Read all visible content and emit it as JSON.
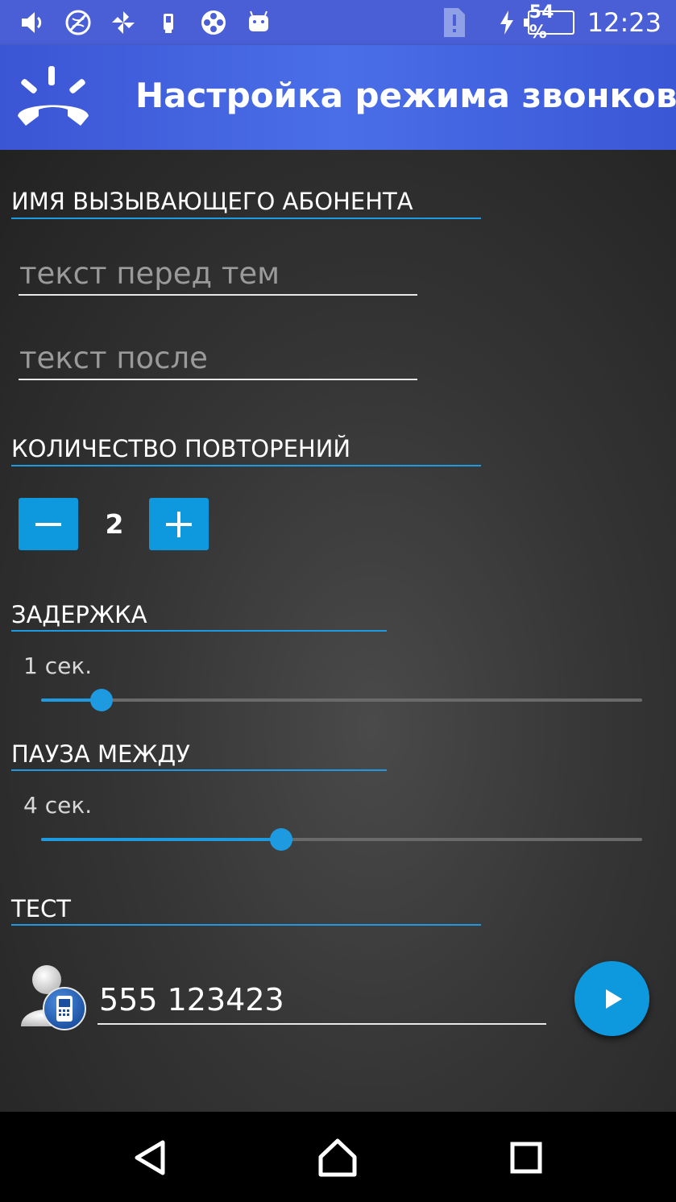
{
  "status_bar": {
    "icons": [
      "volume-icon",
      "no-network-icon",
      "pinwheel-icon",
      "device-icon",
      "film-reel-icon",
      "android-icon",
      "alert-sim-icon",
      "charging-icon"
    ],
    "battery": "54 %",
    "time": "12:23"
  },
  "app_bar": {
    "icon": "phone-ringing-icon",
    "title": "Настройка режима звонков"
  },
  "caller_name": {
    "title": "ИМЯ ВЫЗЫВАЮЩЕГО АБОНЕНТА",
    "before_placeholder": "текст перед тем",
    "after_placeholder": "текст после"
  },
  "repeat_count": {
    "title": "КОЛИЧЕСТВО ПОВТОРЕНИЙ",
    "value": "2"
  },
  "delay": {
    "title": "ЗАДЕРЖКА",
    "value_label": "1 сек.",
    "fraction": 0.1
  },
  "pause": {
    "title": "ПАУЗА МЕЖДУ",
    "value_label": "4 сек.",
    "fraction": 0.4
  },
  "test": {
    "title": "ТЕСТ",
    "phone_number": "555 123423"
  },
  "accent_color": "#1e9be0"
}
